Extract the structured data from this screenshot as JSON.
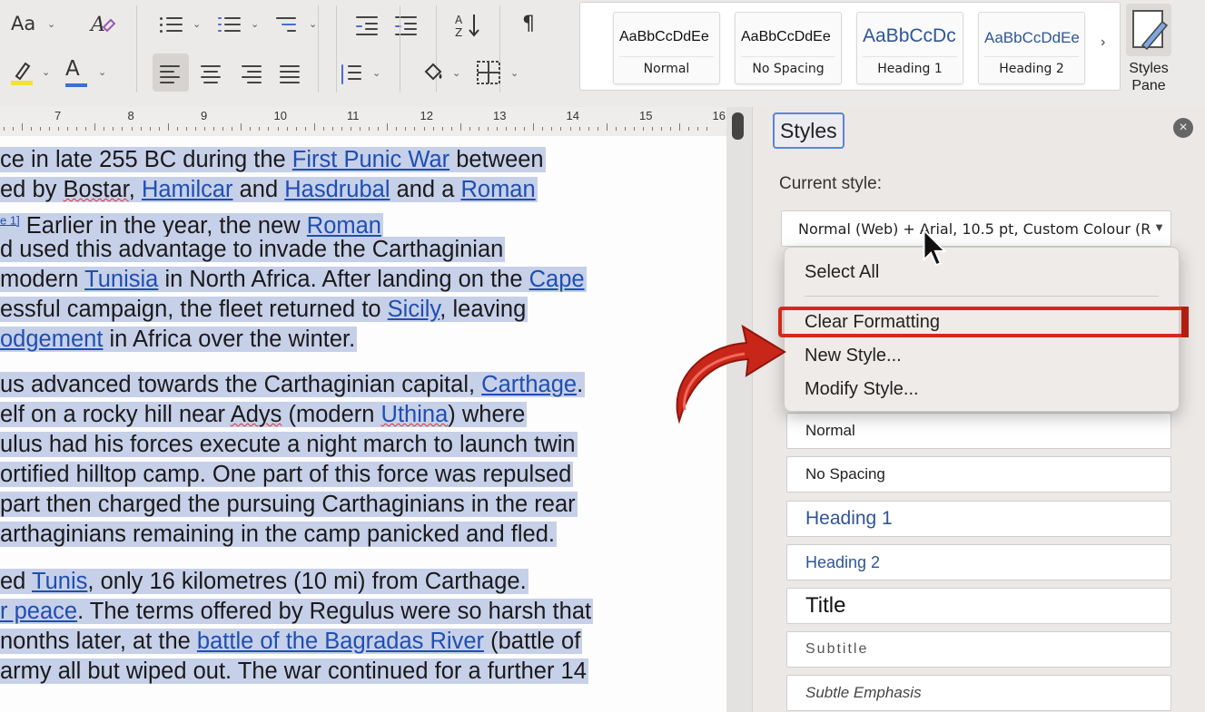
{
  "ribbon": {
    "font_case_label": "Aa",
    "chevron": "⌄",
    "paragraph_mark": "¶",
    "font_color_letter": "A",
    "colors": {
      "highlight": "#f2e32b",
      "font_color": "#3a6fd8",
      "accent_red": "#d42a1a"
    }
  },
  "style_gallery": [
    {
      "sample": "AaBbCcDdEe",
      "name": "Normal"
    },
    {
      "sample": "AaBbCcDdEe",
      "name": "No Spacing"
    },
    {
      "sample": "AaBbCcDc",
      "name": "Heading 1"
    },
    {
      "sample": "AaBbCcDdEe",
      "name": "Heading 2"
    }
  ],
  "gallery_next": "›",
  "styles_pane_button": {
    "line1": "Styles",
    "line2": "Pane"
  },
  "ruler": {
    "numbers": [
      "7",
      "8",
      "9",
      "10",
      "11",
      "12",
      "13",
      "14",
      "15",
      "16"
    ]
  },
  "document": {
    "p1": {
      "l1": {
        "a": "ce in late 255 BC during the ",
        "link1": "First Punic War",
        "b": " between"
      },
      "l2": {
        "a": "ed by ",
        "sq1": "Bostar",
        "b": ", ",
        "link1": "Hamilcar",
        "c": " and ",
        "link2": "Hasdrubal",
        "d": " and a ",
        "link3": "Roman"
      },
      "l3": {
        "note": "e 1]",
        "a": " Earlier in the year, the new ",
        "link1": "Roman"
      },
      "l4": {
        "a": "d used this advantage to invade the Carthaginian"
      },
      "l5": {
        "a": " modern ",
        "link1": "Tunisia",
        "b": " in North Africa. After landing on the ",
        "link2": "Cape"
      },
      "l6": {
        "a": "essful campaign, the fleet returned to ",
        "link1": "Sicily",
        "b": ", leaving"
      },
      "l7": {
        "link1": "odgement",
        "a": " in Africa over the winter."
      }
    },
    "p2": {
      "l1": {
        "a": "us advanced towards the Carthaginian capital, ",
        "link1": "Carthage",
        "b": "."
      },
      "l2": {
        "a": "elf on a rocky hill near ",
        "sq1": "Adys",
        "b": " (modern ",
        "link1": "Uthina",
        "c": ") where"
      },
      "l3": {
        "a": "ulus had his forces execute a night march to launch twin"
      },
      "l4": {
        "a": "ortified hilltop camp. One part of this force was repulsed"
      },
      "l5": {
        "a": "part then charged the pursuing Carthaginians in the rear"
      },
      "l6": {
        "a": "arthaginians remaining in the camp panicked and fled."
      }
    },
    "p3": {
      "l1": {
        "a": "ed ",
        "link1": "Tunis",
        "b": ", only 16 kilometres (10 mi) from Carthage."
      },
      "l2": {
        "link1": "r peace",
        "a": ". The terms offered by Regulus were so harsh that"
      },
      "l3": {
        "a": "nonths later, at the ",
        "link1": "battle of the Bagradas River",
        "b": " (battle of"
      },
      "l4": {
        "a": " army all but wiped out. The war continued for a further 14"
      }
    }
  },
  "styles_pane": {
    "title": "Styles",
    "close_glyph": "×",
    "current_style_label": "Current style:",
    "current_style_value": "Normal (Web) + Arial, 10.5 pt, Custom Colour (R",
    "dropdown_glyph": "▼",
    "menu": {
      "select_all": "Select All",
      "clear_formatting": "Clear Formatting",
      "new_style": "New Style...",
      "modify_style": "Modify Style..."
    },
    "style_list": [
      "Normal",
      "No Spacing",
      "Heading 1",
      "Heading 2",
      "Title",
      "Subtitle",
      "Subtle Emphasis"
    ]
  }
}
